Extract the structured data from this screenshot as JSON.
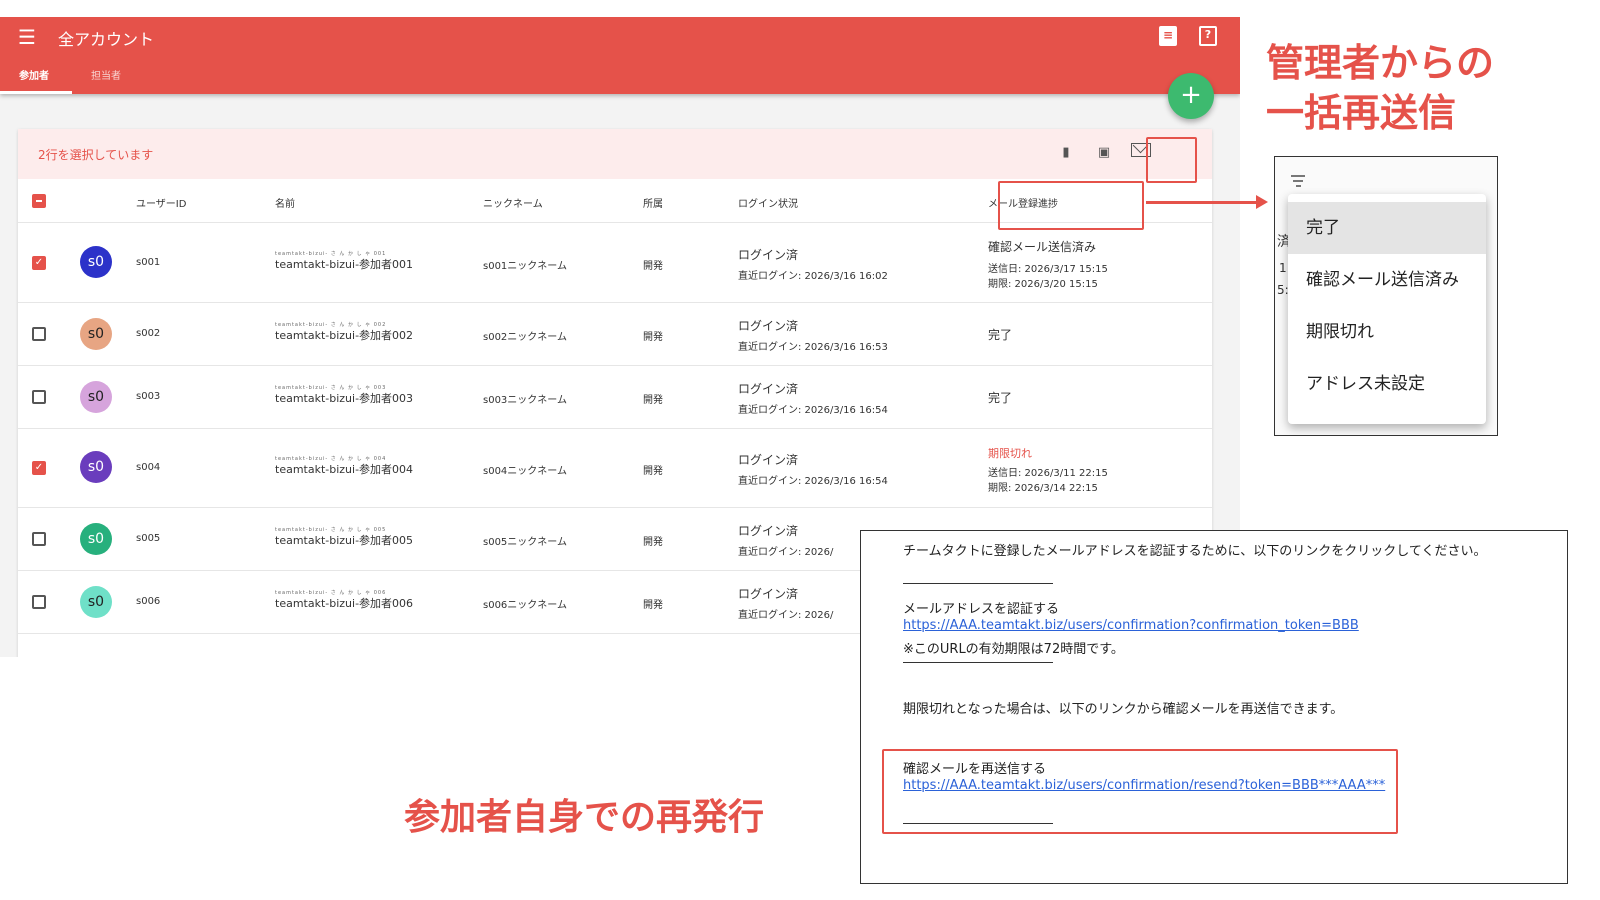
{
  "header": {
    "menu_icon": "☰",
    "title": "全アカウント",
    "tabs": [
      {
        "label": "参加者",
        "active": true
      },
      {
        "label": "担当者",
        "active": false
      }
    ],
    "fab_label": "+"
  },
  "selection_bar": {
    "text": "2行を選択しています"
  },
  "table": {
    "columns": [
      "ユーザーID",
      "名前",
      "ニックネーム",
      "所属",
      "ログイン状況",
      "メール登録進捗"
    ],
    "rows": [
      {
        "checked": true,
        "avatar": "s0",
        "avatar_color": "#2c32c9",
        "id": "s001",
        "ruby": "teamtakt-bizui- さ ん か し ゃ 001",
        "name": "teamtakt-bizui-参加者001",
        "nickname": "s001ニックネーム",
        "dept": "開発",
        "login_status": "ログイン済",
        "last_login": "直近ログイン: 2026/3/16 16:02",
        "mail_status": "確認メール送信済み",
        "mail_sent": "送信日: 2026/3/17 15:15",
        "mail_expiry": "期限: 2026/3/20 15:15",
        "mail_red": false
      },
      {
        "checked": false,
        "avatar": "s0",
        "avatar_color": "#e7a583",
        "id": "s002",
        "ruby": "teamtakt-bizui- さ ん か し ゃ 002",
        "name": "teamtakt-bizui-参加者002",
        "nickname": "s002ニックネーム",
        "dept": "開発",
        "login_status": "ログイン済",
        "last_login": "直近ログイン: 2026/3/16 16:53",
        "mail_status": "完了",
        "mail_sent": "",
        "mail_expiry": "",
        "mail_red": false
      },
      {
        "checked": false,
        "avatar": "s0",
        "avatar_color": "#d6a4dc",
        "id": "s003",
        "ruby": "teamtakt-bizui- さ ん か し ゃ 003",
        "name": "teamtakt-bizui-参加者003",
        "nickname": "s003ニックネーム",
        "dept": "開発",
        "login_status": "ログイン済",
        "last_login": "直近ログイン: 2026/3/16 16:54",
        "mail_status": "完了",
        "mail_sent": "",
        "mail_expiry": "",
        "mail_red": false
      },
      {
        "checked": true,
        "avatar": "s0",
        "avatar_color": "#6a3dbd",
        "id": "s004",
        "ruby": "teamtakt-bizui- さ ん か し ゃ 004",
        "name": "teamtakt-bizui-参加者004",
        "nickname": "s004ニックネーム",
        "dept": "開発",
        "login_status": "ログイン済",
        "last_login": "直近ログイン: 2026/3/16 16:54",
        "mail_status": "期限切れ",
        "mail_sent": "送信日: 2026/3/11 22:15",
        "mail_expiry": "期限: 2026/3/14 22:15",
        "mail_red": true
      },
      {
        "checked": false,
        "avatar": "s0",
        "avatar_color": "#27b07d",
        "id": "s005",
        "ruby": "teamtakt-bizui- さ ん か し ゃ 005",
        "name": "teamtakt-bizui-参加者005",
        "nickname": "s005ニックネーム",
        "dept": "開発",
        "login_status": "ログイン済",
        "last_login": "直近ログイン: 2026/",
        "mail_status": "",
        "mail_sent": "",
        "mail_expiry": "",
        "mail_red": false
      },
      {
        "checked": false,
        "avatar": "s0",
        "avatar_color": "#6fe0c8",
        "id": "s006",
        "ruby": "teamtakt-bizui- さ ん か し ゃ 006",
        "name": "teamtakt-bizui-参加者006",
        "nickname": "s006ニックネーム",
        "dept": "開発",
        "login_status": "ログイン済",
        "last_login": "直近ログイン: 2026/",
        "mail_status": "",
        "mail_sent": "",
        "mail_expiry": "",
        "mail_red": false
      }
    ]
  },
  "annotations": {
    "top_line1": "管理者からの",
    "top_line2": "一括再送信",
    "bottom": "参加者自身での再発行"
  },
  "filter_menu": {
    "fragments": [
      "済",
      "1",
      "5:"
    ],
    "options": [
      {
        "label": "完了",
        "selected": true
      },
      {
        "label": "確認メール送信済み",
        "selected": false
      },
      {
        "label": "期限切れ",
        "selected": false
      },
      {
        "label": "アドレス未設定",
        "selected": false
      }
    ]
  },
  "email": {
    "intro": "チームタクトに登録したメールアドレスを認証するために、以下のリンクをクリックしてください。",
    "verify_label": "メールアドレスを認証する",
    "verify_link": "https://AAA.teamtakt.biz/users/confirmation?confirmation_token=BBB",
    "validity_note": "※このURLの有効期限は72時間です。",
    "expired_note": "期限切れとなった場合は、以下のリンクから確認メールを再送信できます。",
    "resend_label": "確認メールを再送信する",
    "resend_link": "https://AAA.teamtakt.biz/users/confirmation/resend?token=BBB***AAA***"
  },
  "colors": {
    "brand": "#e5524a",
    "fab": "#3dba6f",
    "link": "#2b62d8"
  },
  "icons": [
    "menu-icon",
    "clipboard-icon",
    "help-icon",
    "add-icon",
    "trash-icon",
    "archive-icon",
    "mail-icon",
    "filter-icon",
    "check-icon"
  ]
}
